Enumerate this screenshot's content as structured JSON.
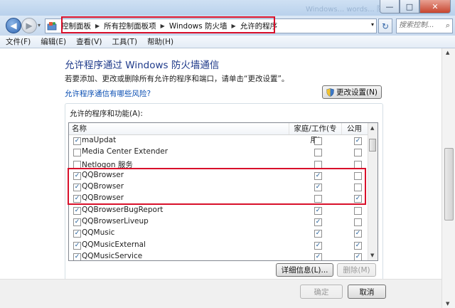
{
  "window": {
    "ghost_title": "Windows... words... 防火墙",
    "controls": {
      "minimize": "—",
      "maximize": "□",
      "close": "✕"
    }
  },
  "nav": {
    "back_icon": "◀",
    "forward_icon": "▶",
    "dropdown": "▾"
  },
  "address": {
    "crumbs": [
      "控制面板",
      "所有控制面板项",
      "Windows 防火墙",
      "允许的程序"
    ],
    "separator": "▶",
    "dropdown": "▾"
  },
  "refresh_icon": "↻",
  "search": {
    "placeholder": "搜索控制...",
    "icon": "⌕"
  },
  "menu": [
    "文件(F)",
    "编辑(E)",
    "查看(V)",
    "工具(T)",
    "帮助(H)"
  ],
  "heading": "允许程序通过 Windows 防火墙通信",
  "subtitle": "若要添加、更改或删除所有允许的程序和端口，请单击“更改设置”。",
  "risk_link": "允许程序通信有哪些风险?",
  "change_settings": "更改设置(N)",
  "group_label": "允许的程序和功能(A):",
  "columns": {
    "name": "名称",
    "home": "家庭/工作(专用)",
    "public": "公用"
  },
  "check_mark": "✓",
  "programs": [
    {
      "name": "maUpdat",
      "enabled": true,
      "home": false,
      "public": true
    },
    {
      "name": "Media Center Extender",
      "enabled": false,
      "home": false,
      "public": false
    },
    {
      "name": "Netlogon 服务",
      "enabled": false,
      "home": false,
      "public": false
    },
    {
      "name": "QQBrowser",
      "enabled": true,
      "home": true,
      "public": false
    },
    {
      "name": "QQBrowser",
      "enabled": true,
      "home": true,
      "public": false
    },
    {
      "name": "QQBrowser",
      "enabled": true,
      "home": false,
      "public": true
    },
    {
      "name": "QQBrowserBugReport",
      "enabled": true,
      "home": true,
      "public": false
    },
    {
      "name": "QQBrowserLiveup",
      "enabled": true,
      "home": true,
      "public": false
    },
    {
      "name": "QQMusic",
      "enabled": true,
      "home": true,
      "public": true
    },
    {
      "name": "QQMusicExternal",
      "enabled": true,
      "home": true,
      "public": true
    },
    {
      "name": "QQMusicService",
      "enabled": true,
      "home": true,
      "public": true
    }
  ],
  "details_button": "详细信息(L)...",
  "remove_button": "删除(M)",
  "ok_button": "确定",
  "cancel_button": "取消",
  "colors": {
    "highlight": "#d8102a",
    "heading": "#1e3a8a",
    "link": "#0b4fb3"
  }
}
